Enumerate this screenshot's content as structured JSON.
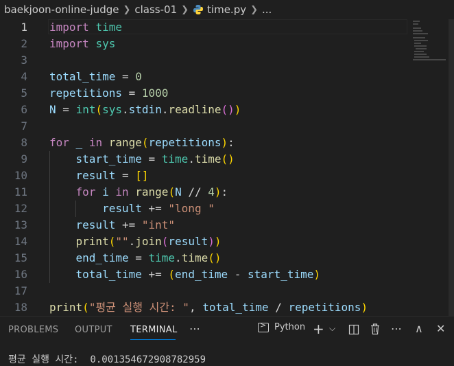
{
  "breadcrumb": {
    "folder1": "baekjoon-online-judge",
    "folder2": "class-01",
    "file": "time.py",
    "more": "..."
  },
  "editor": {
    "line_numbers": [
      "1",
      "2",
      "3",
      "4",
      "5",
      "6",
      "7",
      "8",
      "9",
      "10",
      "11",
      "12",
      "13",
      "14",
      "15",
      "16",
      "17",
      "18"
    ],
    "active_line": 1
  },
  "panel": {
    "tabs": [
      "PROBLEMS",
      "OUTPUT",
      "TERMINAL"
    ],
    "active_tab": "TERMINAL",
    "more": "⋯",
    "terminal_label": "Python",
    "add_icon": "+",
    "chevron": "⌵",
    "split_icon": "◫",
    "trash_icon": "🗑",
    "dots": "⋯",
    "maximize_icon": "∧",
    "close_icon": "✕"
  },
  "terminal": {
    "output": "평균 실행 시간:  0.001354672908782959"
  },
  "colors": {
    "background": "#1f1f1f",
    "keyword": "#c586c0",
    "variable": "#9cdcfe",
    "function": "#dcdcaa",
    "string": "#ce9178",
    "number": "#b5cea8",
    "accent": "#0078d4"
  }
}
